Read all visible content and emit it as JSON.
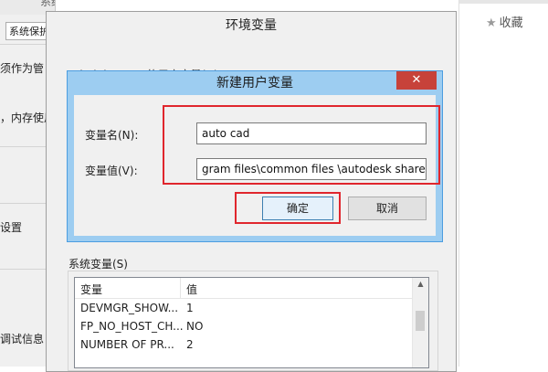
{
  "background_left": {
    "title_fragment": "系统属性",
    "tab_label": "系统保护",
    "lines": [
      "须作为管",
      "，内存使用",
      "设置",
      "调试信息"
    ]
  },
  "background_right": {
    "favorites_label": "收藏"
  },
  "env_window": {
    "title": "环境变量",
    "user_group_label": "Administrator 的用户变量(U)",
    "system_group_label": "系统变量(S)",
    "system_table": {
      "columns": [
        "变量",
        "值"
      ],
      "rows": [
        {
          "name": "DEVMGR_SHOW...",
          "value": "1"
        },
        {
          "name": "FP_NO_HOST_CH...",
          "value": "NO"
        },
        {
          "name": "NUMBER OF PR...",
          "value": "2"
        }
      ]
    }
  },
  "new_var_dialog": {
    "title": "新建用户变量",
    "close_glyph": "✕",
    "name_label": "变量名(N):",
    "name_value": "auto cad",
    "value_label": "变量值(V):",
    "value_value": "gram files\\common files \\autodesk shared",
    "ok_label": "确定",
    "cancel_label": "取消"
  },
  "colors": {
    "annotation_red": "#e0262d",
    "dialog_frame": "#9dcdf1",
    "close_button": "#c7423a"
  }
}
